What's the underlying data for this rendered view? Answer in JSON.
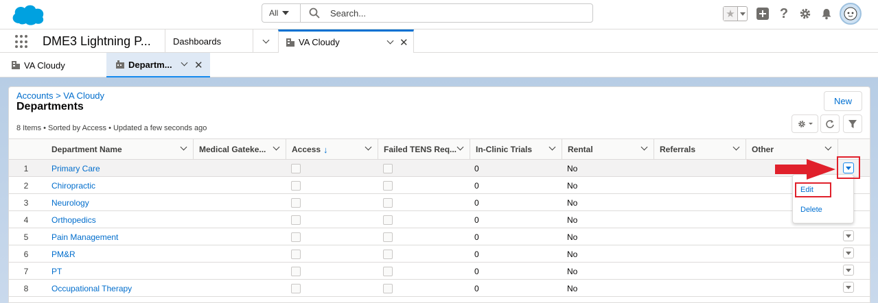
{
  "header": {
    "search_scope": "All",
    "search_placeholder": "Search...",
    "icons": [
      "star-icon",
      "add-icon",
      "help-icon",
      "setup-gear-icon",
      "notification-bell-icon",
      "user-avatar-icon"
    ]
  },
  "nav": {
    "app_name": "DME3 Lightning P...",
    "tabs": [
      {
        "label": "Dashboards",
        "active": false
      },
      {
        "label": "VA Cloudy",
        "active": true
      }
    ]
  },
  "subtabs": [
    {
      "label": "VA Cloudy",
      "active": false
    },
    {
      "label": "Departm...",
      "active": true
    }
  ],
  "list": {
    "breadcrumb": "Accounts > VA Cloudy",
    "title": "Departments",
    "meta": "8 Items • Sorted by Access • Updated a few seconds ago",
    "new_label": "New",
    "columns": [
      "Department Name",
      "Medical Gateke...",
      "Access",
      "Failed TENS Req...",
      "In-Clinic Trials",
      "Rental",
      "Referrals",
      "Other"
    ],
    "sort_indicator": "↓",
    "rows": [
      {
        "num": "1",
        "name": "Primary Care",
        "trials": "0",
        "rental": "No"
      },
      {
        "num": "2",
        "name": "Chiropractic",
        "trials": "0",
        "rental": "No"
      },
      {
        "num": "3",
        "name": "Neurology",
        "trials": "0",
        "rental": "No"
      },
      {
        "num": "4",
        "name": "Orthopedics",
        "trials": "0",
        "rental": "No"
      },
      {
        "num": "5",
        "name": "Pain Management",
        "trials": "0",
        "rental": "No"
      },
      {
        "num": "6",
        "name": "PM&R",
        "trials": "0",
        "rental": "No"
      },
      {
        "num": "7",
        "name": "PT",
        "trials": "0",
        "rental": "No"
      },
      {
        "num": "8",
        "name": "Occupational Therapy",
        "trials": "0",
        "rental": "No"
      }
    ]
  },
  "row_menu": {
    "edit": "Edit",
    "delete": "Delete"
  },
  "colors": {
    "brand": "#00a1e0",
    "link": "#006dcc",
    "accent": "#0070d2",
    "annotation": "#e0202b"
  }
}
